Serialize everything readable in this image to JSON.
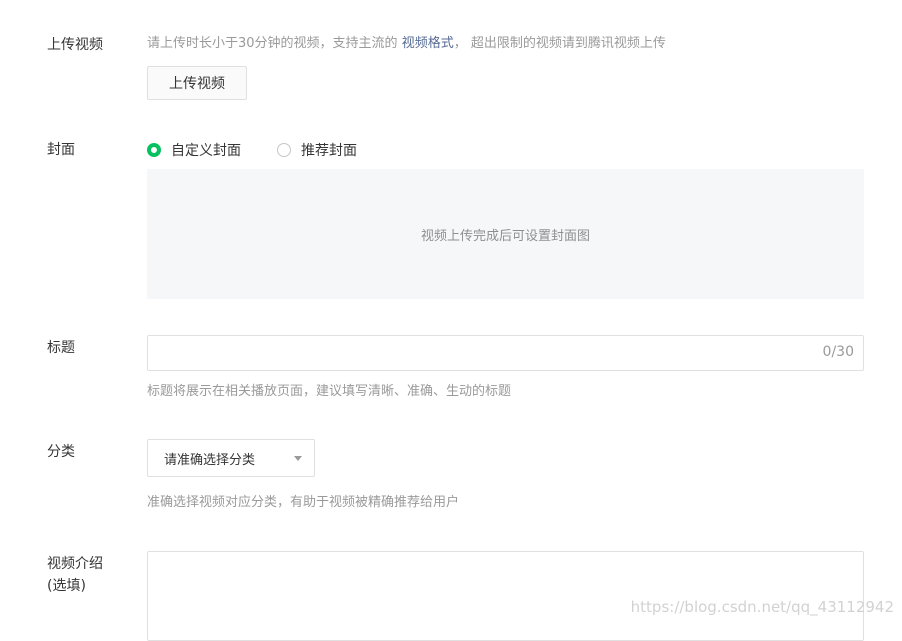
{
  "upload": {
    "label": "上传视频",
    "hint_before": "请上传时长小于30分钟的视频，支持主流的 ",
    "hint_link": "视频格式",
    "hint_after": "， 超出限制的视频请到腾讯视频上传",
    "button": "上传视频"
  },
  "cover": {
    "label": "封面",
    "options": [
      {
        "label": "自定义封面",
        "selected": true
      },
      {
        "label": "推荐封面",
        "selected": false
      }
    ],
    "placeholder": "视频上传完成后可设置封面图"
  },
  "title": {
    "label": "标题",
    "counter": "0/30",
    "hint": "标题将展示在相关播放页面，建议填写清晰、准确、生动的标题"
  },
  "category": {
    "label": "分类",
    "selected": "请准确选择分类",
    "hint": "准确选择视频对应分类，有助于视频被精确推荐给用户"
  },
  "intro": {
    "label_line1": "视频介绍",
    "label_line2": "(选填)"
  },
  "watermark": "https://blog.csdn.net/qq_43112942",
  "colors": {
    "accent": "#07c160",
    "link": "#576b95",
    "hint": "#9a9a9a"
  }
}
